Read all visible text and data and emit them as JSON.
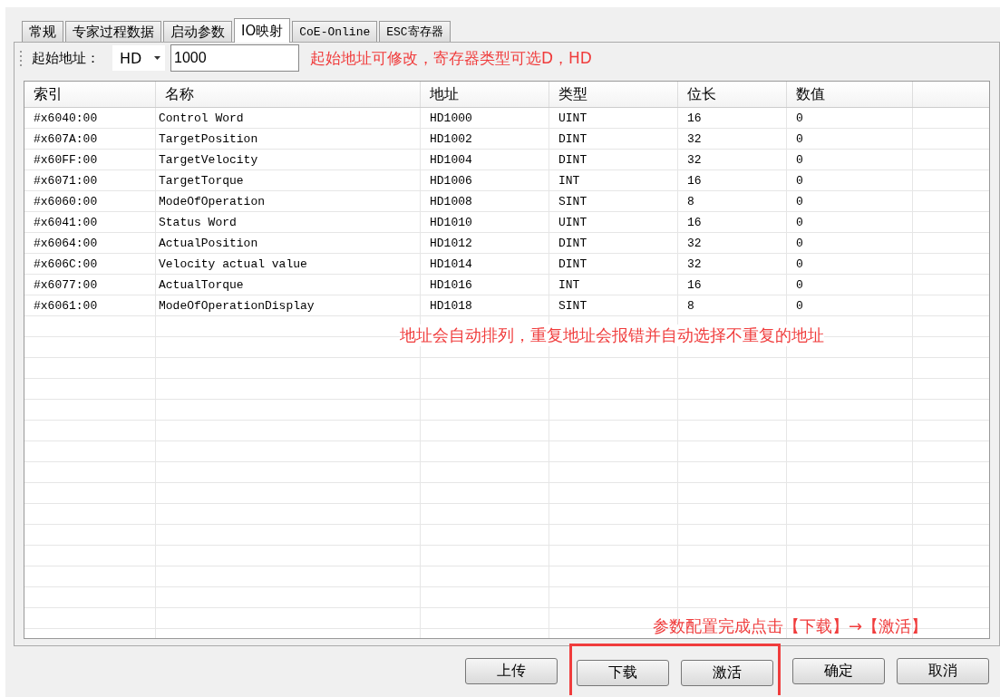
{
  "tabs": [
    {
      "label": "常规",
      "selected": false
    },
    {
      "label": "专家过程数据",
      "selected": false
    },
    {
      "label": "启动参数",
      "selected": false
    },
    {
      "label": "IO映射",
      "selected": true
    },
    {
      "label": "CoE-Online",
      "selected": false
    },
    {
      "label": "ESC寄存器",
      "selected": false
    }
  ],
  "toolbar": {
    "label": "起始地址：",
    "register_type": "HD",
    "start_address": "1000",
    "note": "起始地址可修改，寄存器类型可选D，HD"
  },
  "table": {
    "columns": [
      "索引",
      "名称",
      "地址",
      "类型",
      "位长",
      "数值"
    ],
    "rows": [
      [
        "#x6040:00",
        "Control Word",
        "HD1000",
        "UINT",
        "16",
        "0"
      ],
      [
        "#x607A:00",
        "TargetPosition",
        "HD1002",
        "DINT",
        "32",
        "0"
      ],
      [
        "#x60FF:00",
        "TargetVelocity",
        "HD1004",
        "DINT",
        "32",
        "0"
      ],
      [
        "#x6071:00",
        "TargetTorque",
        "HD1006",
        "INT",
        "16",
        "0"
      ],
      [
        "#x6060:00",
        "ModeOfOperation",
        "HD1008",
        "SINT",
        "8",
        "0"
      ],
      [
        "#x6041:00",
        "Status Word",
        "HD1010",
        "UINT",
        "16",
        "0"
      ],
      [
        "#x6064:00",
        "ActualPosition",
        "HD1012",
        "DINT",
        "32",
        "0"
      ],
      [
        "#x606C:00",
        "Velocity actual value",
        "HD1014",
        "DINT",
        "32",
        "0"
      ],
      [
        "#x6077:00",
        "ActualTorque",
        "HD1016",
        "INT",
        "16",
        "0"
      ],
      [
        "#x6061:00",
        "ModeOfOperationDisplay",
        "HD1018",
        "SINT",
        "8",
        "0"
      ]
    ],
    "note": "地址会自动排列，重复地址会报错并自动选择不重复的地址"
  },
  "footer_note": "参数配置完成点击【下载】→【激活】",
  "buttons": [
    {
      "label": "上传",
      "highlighted": false
    },
    {
      "label": "下载",
      "highlighted": true
    },
    {
      "label": "激活",
      "highlighted": true
    },
    {
      "label": "确定",
      "highlighted": false
    },
    {
      "label": "取消",
      "highlighted": false
    }
  ]
}
